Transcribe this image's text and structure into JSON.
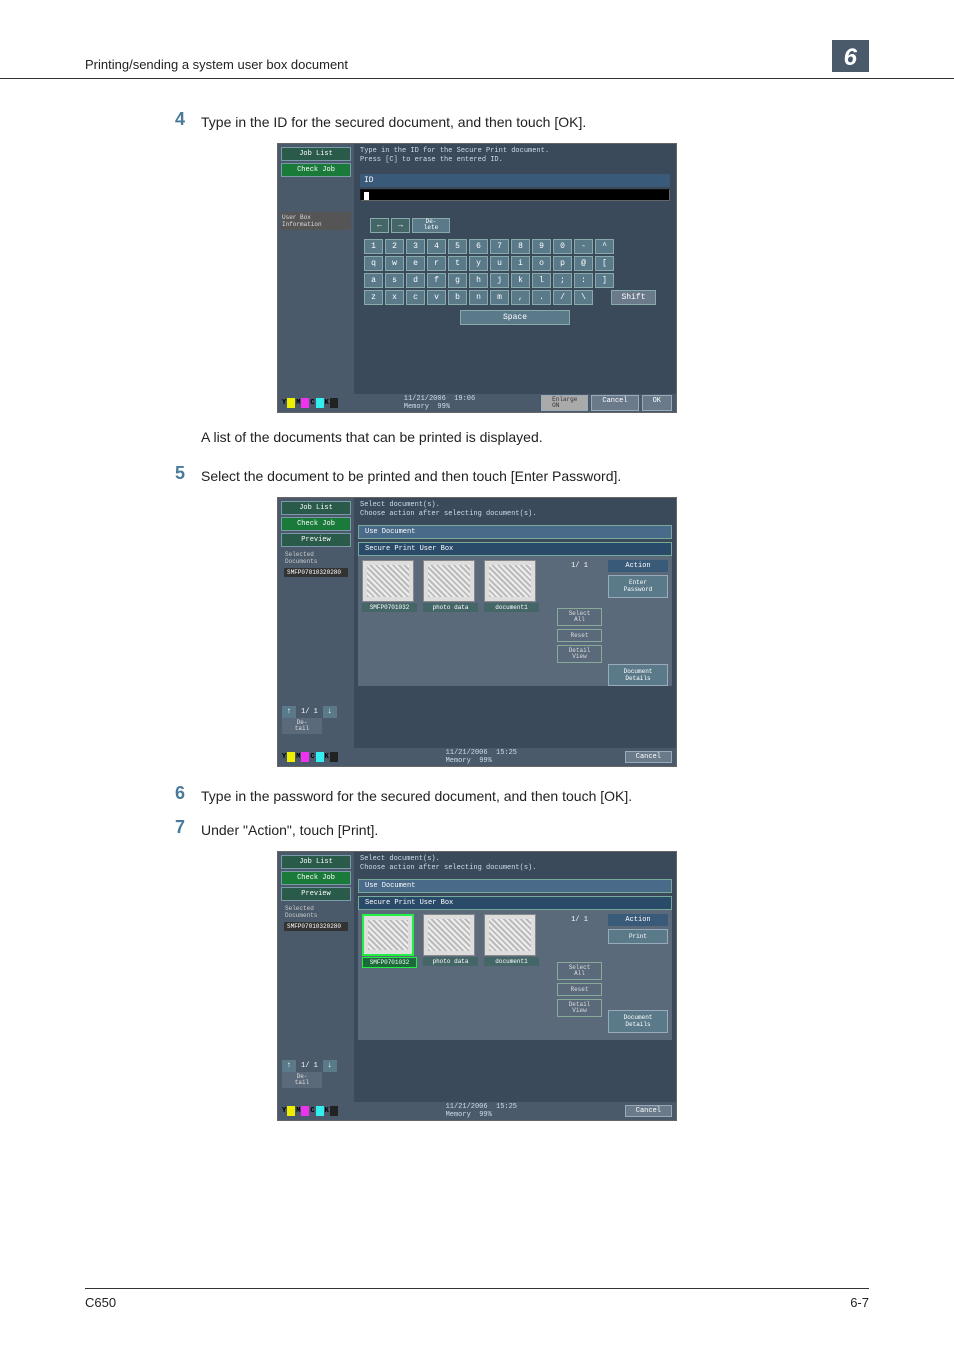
{
  "header": {
    "title": "Printing/sending a system user box document",
    "chapter": "6"
  },
  "footer": {
    "model": "C650",
    "page": "6-7"
  },
  "steps": {
    "s4": {
      "num": "4",
      "text": "Type in the ID for the secured document, and then touch [OK]."
    },
    "s4_after": "A list of the documents that can be printed is displayed.",
    "s5": {
      "num": "5",
      "text": "Select the document to be printed and then touch [Enter Password]."
    },
    "s6": {
      "num": "6",
      "text": "Type in the password for the secured document, and then touch [OK]."
    },
    "s7": {
      "num": "7",
      "text": "Under \"Action\", touch [Print]."
    }
  },
  "panel1": {
    "left": {
      "joblist": "Job List",
      "checkjob": "Check Job",
      "userbox": "User Box\nInformation"
    },
    "msg": "Type in the ID for the Secure Print document.\nPress [C] to erase the entered ID.",
    "id_label": "ID",
    "kb": {
      "nav": [
        "←",
        "→",
        "De-\nlete"
      ],
      "row1": [
        "1",
        "2",
        "3",
        "4",
        "5",
        "6",
        "7",
        "8",
        "9",
        "0",
        "-",
        "^"
      ],
      "row2": [
        "q",
        "w",
        "e",
        "r",
        "t",
        "y",
        "u",
        "i",
        "o",
        "p",
        "@",
        "["
      ],
      "row3": [
        "a",
        "s",
        "d",
        "f",
        "g",
        "h",
        "j",
        "k",
        "l",
        ";",
        ":",
        "]"
      ],
      "row4": [
        "z",
        "x",
        "c",
        "v",
        "b",
        "n",
        "m",
        ",",
        ".",
        "/",
        "\\"
      ],
      "shift": "Shift",
      "space": "Space"
    },
    "footer": {
      "date": "11/21/2006",
      "time": "19:06",
      "mem": "Memory",
      "memv": "99%",
      "enlarge": "Enlarge\nON",
      "cancel": "Cancel",
      "ok": "OK"
    }
  },
  "panel2": {
    "left": {
      "joblist": "Job List",
      "checkjob": "Check Job",
      "preview": "Preview",
      "seldoc_hdr": "Selected Documents",
      "seldoc": "SMFP07010320280",
      "page": "1/  1",
      "detail": "De-\ntail"
    },
    "msg": "Select document(s).\nChoose action after selecting document(s).",
    "tab1": "Use Document",
    "tab2": "Secure Print User Box",
    "thumbs": [
      {
        "label": "SMFP0701032"
      },
      {
        "label": "photo data"
      },
      {
        "label": "document1"
      }
    ],
    "mid": {
      "page": "1/  1",
      "selectall": "Select\nAll",
      "reset": "Reset",
      "detailview": "Detail\nView"
    },
    "right": {
      "action": "Action",
      "enterpw": "Enter\nPassword",
      "docdetails": "Document\nDetails"
    },
    "footer": {
      "date": "11/21/2006",
      "time": "15:25",
      "mem": "Memory",
      "memv": "99%",
      "cancel": "Cancel"
    }
  },
  "panel3": {
    "left": {
      "joblist": "Job List",
      "checkjob": "Check Job",
      "preview": "Preview",
      "seldoc_hdr": "Selected Documents",
      "seldoc": "SMFP07010320280",
      "page": "1/  1",
      "detail": "De-\ntail"
    },
    "msg": "Select document(s).\nChoose action after selecting document(s).",
    "tab1": "Use Document",
    "tab2": "Secure Print User Box",
    "thumbs": [
      {
        "label": "SMFP0701032"
      },
      {
        "label": "photo data"
      },
      {
        "label": "document1"
      }
    ],
    "mid": {
      "page": "1/  1",
      "selectall": "Select\nAll",
      "reset": "Reset",
      "detailview": "Detail\nView"
    },
    "right": {
      "action": "Action",
      "print": "Print",
      "docdetails": "Document\nDetails"
    },
    "footer": {
      "date": "11/21/2006",
      "time": "15:25",
      "mem": "Memory",
      "memv": "99%",
      "cancel": "Cancel"
    }
  }
}
